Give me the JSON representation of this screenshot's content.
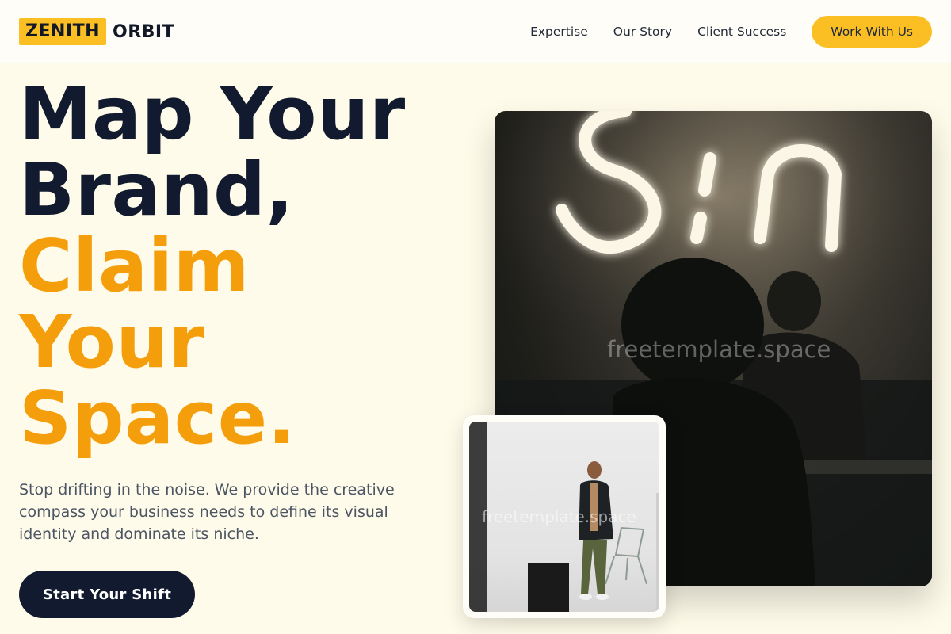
{
  "brand": {
    "highlight": "ZENITH",
    "word": "ORBIT"
  },
  "nav": {
    "items": [
      "Expertise",
      "Our Story",
      "Client Success"
    ],
    "cta": "Work With Us"
  },
  "hero": {
    "headline_dark": [
      "Map Your",
      "Brand,"
    ],
    "headline_accent": [
      "Claim",
      "Your",
      "Space."
    ],
    "subtitle": "Stop drifting in the noise. We provide the creative compass your business needs to define its visual identity and dominate its niche.",
    "button": "Start Your Shift"
  },
  "images": {
    "main_watermark": "freetemplate.space",
    "small_watermark": "freetemplate.space"
  },
  "colors": {
    "accent": "#fbbf24",
    "accent_text": "#f59e0b",
    "dark": "#111a2e",
    "background": "#fffbea"
  }
}
